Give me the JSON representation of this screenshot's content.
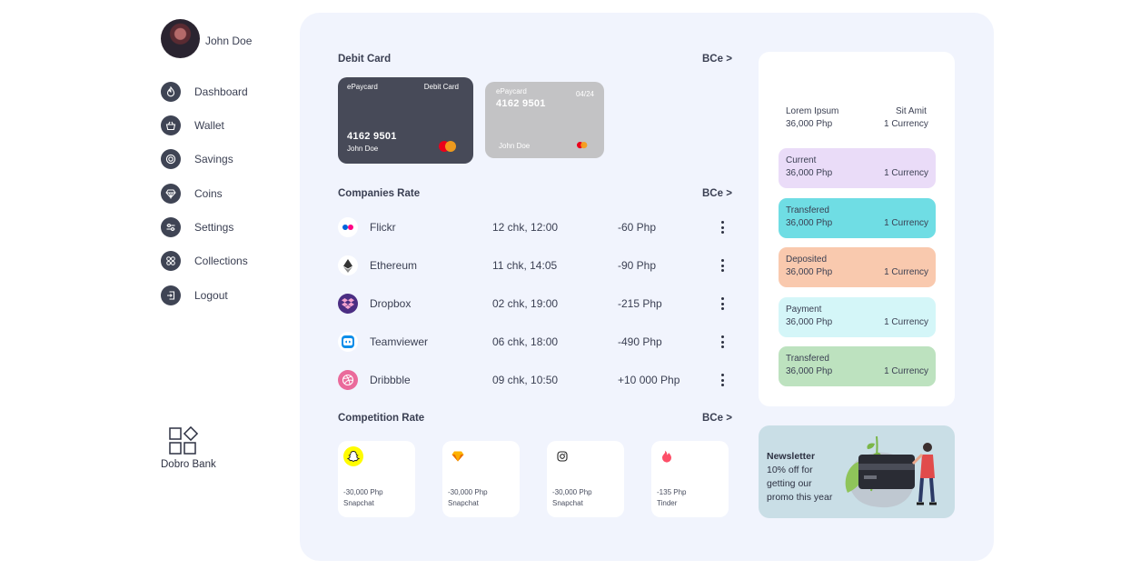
{
  "user": {
    "name": "John Doe"
  },
  "sidebar": {
    "items": [
      {
        "label": "Dashboard",
        "icon": "flame-icon"
      },
      {
        "label": "Wallet",
        "icon": "basket-icon"
      },
      {
        "label": "Savings",
        "icon": "target-icon"
      },
      {
        "label": "Coins",
        "icon": "diamond-icon"
      },
      {
        "label": "Settings",
        "icon": "sliders-icon"
      },
      {
        "label": "Collections",
        "icon": "grid-icon"
      },
      {
        "label": "Logout",
        "icon": "logout-icon"
      }
    ]
  },
  "brand": {
    "name": "Dobro Bank"
  },
  "debit": {
    "title": "Debit Card",
    "more": "BCe >",
    "card1": {
      "brand": "ePaycard",
      "type": "Debit Card",
      "number": "4162 9501",
      "holder": "John Doe"
    },
    "card2": {
      "brand": "ePaycard",
      "expiry": "04/24",
      "number": "4162 9501",
      "holder": "John Doe"
    }
  },
  "companies": {
    "title": "Companies Rate",
    "more": "BCe >",
    "rows": [
      {
        "name": "Flickr",
        "time": "12 chk, 12:00",
        "amount": "-60 Php",
        "icon": "flickr-icon"
      },
      {
        "name": "Ethereum",
        "time": "11 chk, 14:05",
        "amount": "-90 Php",
        "icon": "ethereum-icon"
      },
      {
        "name": "Dropbox",
        "time": "02 chk, 19:00",
        "amount": "-215 Php",
        "icon": "dropbox-icon"
      },
      {
        "name": "Teamviewer",
        "time": "06 chk, 18:00",
        "amount": "-490 Php",
        "icon": "teamviewer-icon"
      },
      {
        "name": "Dribbble",
        "time": "09 chk, 10:50",
        "amount": "+10 000 Php",
        "icon": "dribbble-icon"
      }
    ]
  },
  "competition": {
    "title": "Competition Rate",
    "more": "BCe >",
    "cards": [
      {
        "amount": "-30,000 Php",
        "name": "Snapchat",
        "icon": "snapchat-icon"
      },
      {
        "amount": "-30,000 Php",
        "name": "Snapchat",
        "icon": "sketch-icon"
      },
      {
        "amount": "-30,000 Php",
        "name": "Snapchat",
        "icon": "instagram-icon"
      },
      {
        "amount": "-135 Php",
        "name": "Tinder",
        "icon": "tinder-icon"
      }
    ]
  },
  "summary": {
    "left_label": "Lorem Ipsum",
    "left_amount": "36,000 Php",
    "right_label": "Sit Amit",
    "right_amount": "1 Currency"
  },
  "transactions": [
    {
      "label": "Current",
      "amount": "36,000 Php",
      "currency": "1 Currency",
      "color": "#eadcf8"
    },
    {
      "label": "Transfered",
      "amount": "36,000 Php",
      "currency": "1 Currency",
      "color": "#6fdde4"
    },
    {
      "label": "Deposited",
      "amount": "36,000 Php",
      "currency": "1 Currency",
      "color": "#f9c9ae"
    },
    {
      "label": "Payment",
      "amount": "36,000 Php",
      "currency": "1 Currency",
      "color": "#d4f6f8"
    },
    {
      "label": "Transfered",
      "amount": "36,000 Php",
      "currency": "1 Currency",
      "color": "#bde2bf"
    }
  ],
  "newsletter": {
    "title": "Newsletter",
    "line1": "10% off for",
    "line2": "getting our",
    "line3": "promo this year"
  }
}
